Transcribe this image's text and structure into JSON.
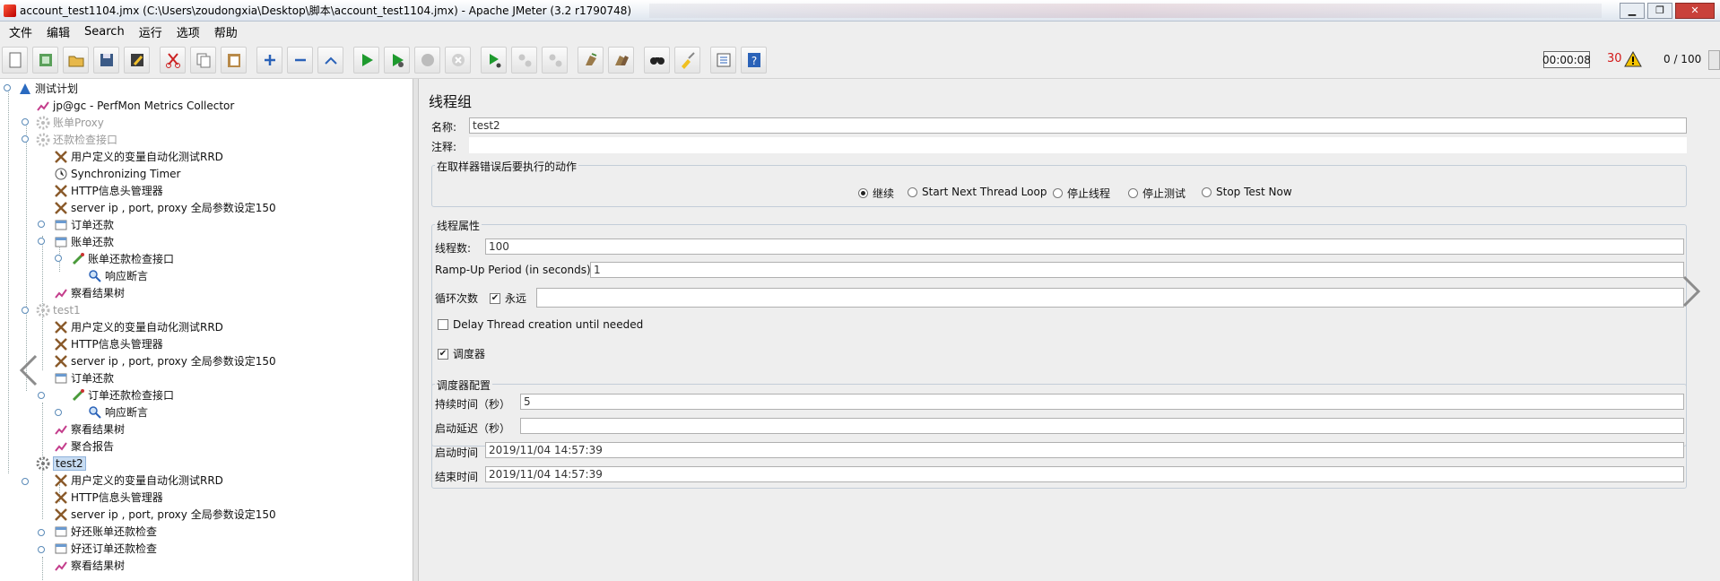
{
  "window": {
    "title": "account_test1104.jmx (C:\\Users\\zoudongxia\\Desktop\\脚本\\account_test1104.jmx) - Apache JMeter (3.2 r1790748)",
    "controls": [
      "minimize-icon",
      "maximize-icon",
      "close-icon"
    ]
  },
  "menu": [
    "文件",
    "编辑",
    "Search",
    "运行",
    "选项",
    "帮助"
  ],
  "toolbar": {
    "buttons": [
      "new-icon",
      "templates-icon",
      "open-icon",
      "save-icon",
      "save-as-icon",
      "cut-icon",
      "copy-icon",
      "paste-icon",
      "expand-icon",
      "collapse-icon",
      "toggle-icon",
      "start-icon",
      "start-no-pause-icon",
      "stop-icon",
      "shutdown-icon",
      "remote-start-icon",
      "remote-stop-icon",
      "remote-shutdown-icon",
      "clear-icon",
      "clear-all-icon",
      "search-icon",
      "reset-search-icon",
      "function-helper-icon",
      "help-icon"
    ],
    "timer": "00:00:08",
    "error_count": "30",
    "threads": "0 / 100"
  },
  "tree": [
    {
      "label": "测试计划",
      "icon": "test-plan-icon"
    },
    {
      "label": "jp@gc - PerfMon Metrics Collector",
      "icon": "listener-icon"
    },
    {
      "label": "账单Proxy",
      "icon": "gear-icon",
      "disabled": true
    },
    {
      "label": "还款检查接口",
      "icon": "gear-icon",
      "disabled": true
    },
    {
      "label": "用户定义的变量自动化测试RRD",
      "icon": "config-icon"
    },
    {
      "label": "Synchronizing Timer",
      "icon": "timer-icon"
    },
    {
      "label": "HTTP信息头管理器",
      "icon": "config-icon"
    },
    {
      "label": "server ip , port, proxy  全局参数设定150",
      "icon": "config-icon"
    },
    {
      "label": "订单还款",
      "icon": "controller-icon"
    },
    {
      "label": "账单还款",
      "icon": "controller-icon"
    },
    {
      "label": "账单还款检查接口",
      "icon": "sampler-icon"
    },
    {
      "label": "响应断言",
      "icon": "assertion-icon"
    },
    {
      "label": "察看结果树",
      "icon": "listener-icon"
    },
    {
      "label": "test1",
      "icon": "gear-icon",
      "disabled": true
    },
    {
      "label": "用户定义的变量自动化测试RRD",
      "icon": "config-icon"
    },
    {
      "label": "HTTP信息头管理器",
      "icon": "config-icon"
    },
    {
      "label": "server ip , port, proxy  全局参数设定150",
      "icon": "config-icon"
    },
    {
      "label": "订单还款",
      "icon": "controller-icon"
    },
    {
      "label": "订单还款检查接口",
      "icon": "sampler-icon"
    },
    {
      "label": "响应断言",
      "icon": "assertion-icon"
    },
    {
      "label": "察看结果树",
      "icon": "listener-icon"
    },
    {
      "label": "聚合报告",
      "icon": "listener-icon"
    },
    {
      "label": "test2",
      "icon": "thread-group-icon",
      "selected": true
    },
    {
      "label": "用户定义的变量自动化测试RRD",
      "icon": "config-icon"
    },
    {
      "label": "HTTP信息头管理器",
      "icon": "config-icon"
    },
    {
      "label": "server ip , port, proxy  全局参数设定150",
      "icon": "config-icon"
    },
    {
      "label": "好还账单还款检查",
      "icon": "controller-icon"
    },
    {
      "label": "好还订单还款检查",
      "icon": "controller-icon"
    },
    {
      "label": "察看结果树",
      "icon": "listener-icon"
    }
  ],
  "panel": {
    "title": "线程组",
    "name_label": "名称:",
    "name_value": "test2",
    "comment_label": "注释:",
    "comment_value": "",
    "error_action": {
      "title": "在取样器错误后要执行的动作",
      "options": [
        "继续",
        "Start Next Thread Loop",
        "停止线程",
        "停止测试",
        "Stop Test Now"
      ],
      "selected": "继续"
    },
    "thread_props": {
      "title": "线程属性",
      "threads_label": "线程数:",
      "threads_value": "100",
      "rampup_label": "Ramp-Up Period (in seconds):",
      "rampup_value": "1",
      "loop_label": "循环次数",
      "forever_label": "永远",
      "forever_checked": true,
      "loop_value": "",
      "delay_label": "Delay Thread creation until needed",
      "delay_checked": false,
      "scheduler_label": "调度器",
      "scheduler_checked": true
    },
    "scheduler": {
      "title": "调度器配置",
      "duration_label": "持续时间（秒）",
      "duration_value": "5",
      "delay_label": "启动延迟（秒）",
      "delay_value": "",
      "start_label": "启动时间",
      "start_value": "2019/11/04 14:57:39",
      "end_label": "结束时间",
      "end_value": "2019/11/04 14:57:39"
    }
  }
}
